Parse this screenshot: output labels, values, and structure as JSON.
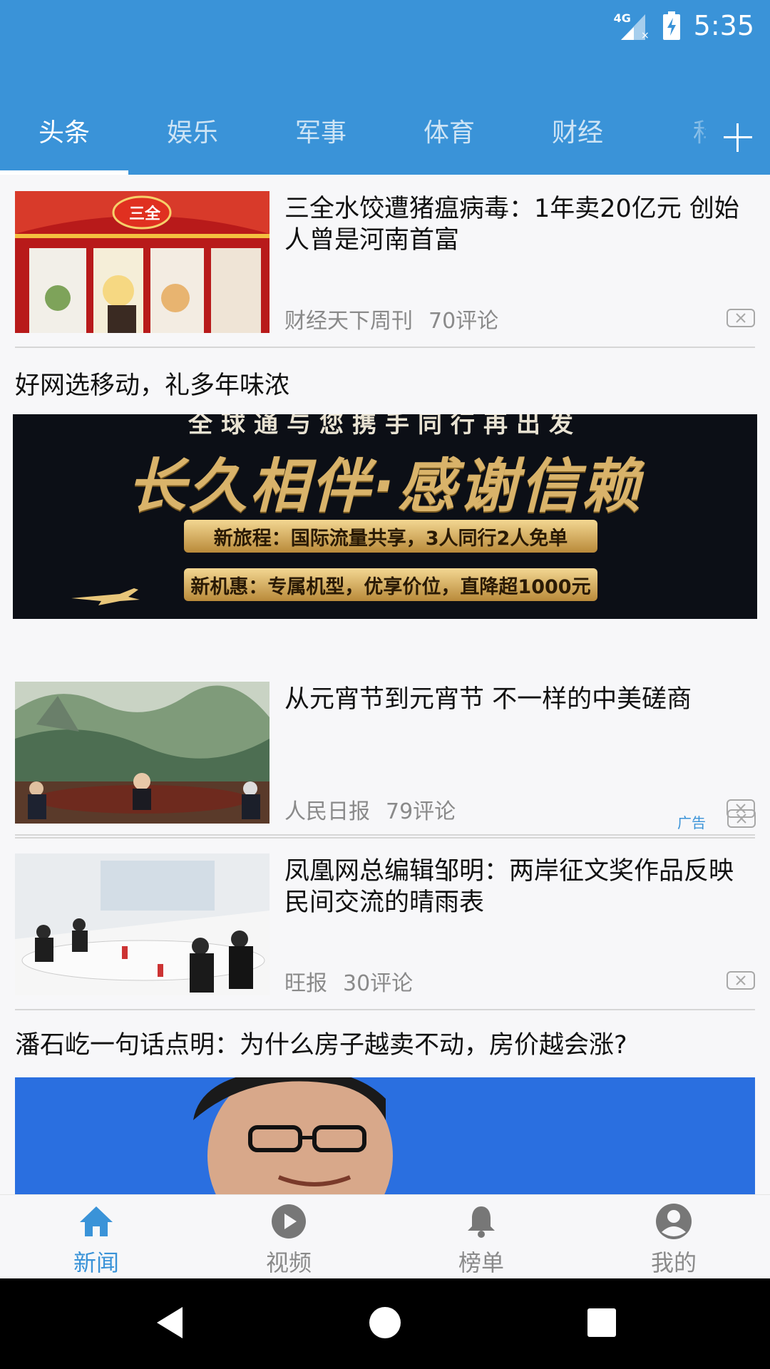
{
  "status_bar": {
    "network": "4G",
    "time": "5:35"
  },
  "tabs": [
    "头条",
    "娱乐",
    "军事",
    "体育",
    "财经",
    "科"
  ],
  "feed": {
    "items": [
      {
        "title": "三全水饺遭猪瘟病毒：1年卖20亿元 创始人曾是河南首富",
        "source": "财经天下周刊",
        "comments": "70评论"
      },
      {
        "title": "从元宵节到元宵节 不一样的中美磋商",
        "source": "人民日报",
        "comments": "79评论"
      },
      {
        "title": "凤凰网总编辑邹明：两岸征文奖作品反映民间交流的晴雨表",
        "source": "旺报",
        "comments": "30评论"
      }
    ],
    "ad": {
      "title": "好网选移动，礼多年味浓",
      "banner_top": "全球通与您携手同行再出发",
      "banner_headline": "长久相伴·感谢信赖",
      "banner_line1": "新旅程：国际流量共享，3人同行2人免单",
      "banner_line2": "新机惠：专属机型，优享价位，直降超1000元",
      "label": "广告"
    },
    "big_item": {
      "title": "潘石屹一句话点明：为什么房子越卖不动，房价越会涨?"
    },
    "thumb1_text": "三全"
  },
  "bottom_nav": [
    "新闻",
    "视频",
    "榜单",
    "我的"
  ],
  "colors": {
    "accent": "#3a93d8",
    "divider": "#d6d6d6",
    "meta": "#8a8a8a"
  }
}
